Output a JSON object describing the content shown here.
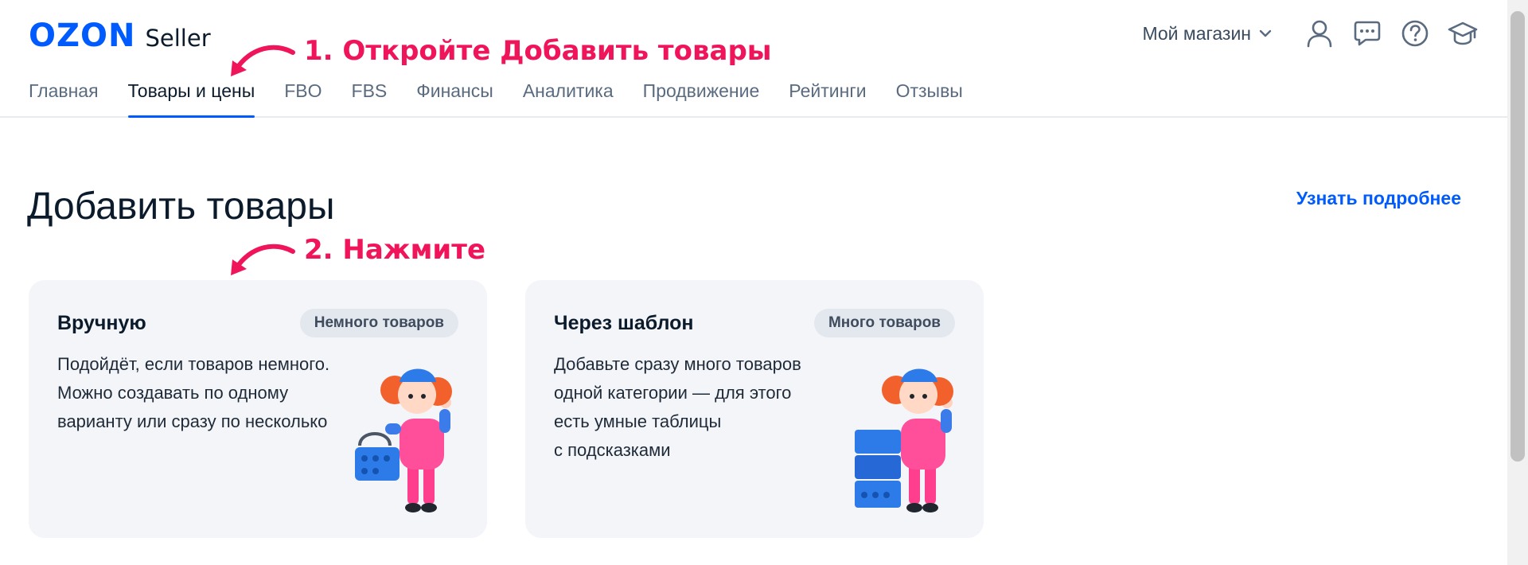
{
  "header": {
    "logo": {
      "brand": "OZON",
      "product": "Seller"
    },
    "nav": [
      {
        "label": "Главная",
        "active": false
      },
      {
        "label": "Товары и цены",
        "active": true
      },
      {
        "label": "FBO",
        "active": false
      },
      {
        "label": "FBS",
        "active": false
      },
      {
        "label": "Финансы",
        "active": false
      },
      {
        "label": "Аналитика",
        "active": false
      },
      {
        "label": "Продвижение",
        "active": false
      },
      {
        "label": "Рейтинги",
        "active": false
      },
      {
        "label": "Отзывы",
        "active": false
      }
    ],
    "store_selector": "Мой магазин",
    "icons": [
      "chevron-down-icon",
      "profile-icon",
      "chat-icon",
      "help-icon",
      "education-icon"
    ]
  },
  "annotations": {
    "step1": "1. Откройте Добавить товары",
    "step2": "2. Нажмите"
  },
  "main": {
    "title": "Добавить товары",
    "learn_more": "Узнать подробнее",
    "cards": [
      {
        "title": "Вручную",
        "badge": "Немного товаров",
        "description": [
          "Подойдёт, если товаров немного.",
          "Можно создавать по одному",
          "варианту или сразу по несколько"
        ],
        "illustration": "mascot-with-basket"
      },
      {
        "title": "Через шаблон",
        "badge": "Много товаров",
        "description": [
          "Добавьте сразу много товаров",
          "одной категории — для этого",
          "есть умные таблицы",
          "с подсказками"
        ],
        "illustration": "mascot-with-boxes"
      }
    ]
  },
  "colors": {
    "brand": "#005bff",
    "annotation": "#f0145a",
    "card_bg": "#f4f5f9",
    "badge_bg": "#e3e7ee"
  }
}
